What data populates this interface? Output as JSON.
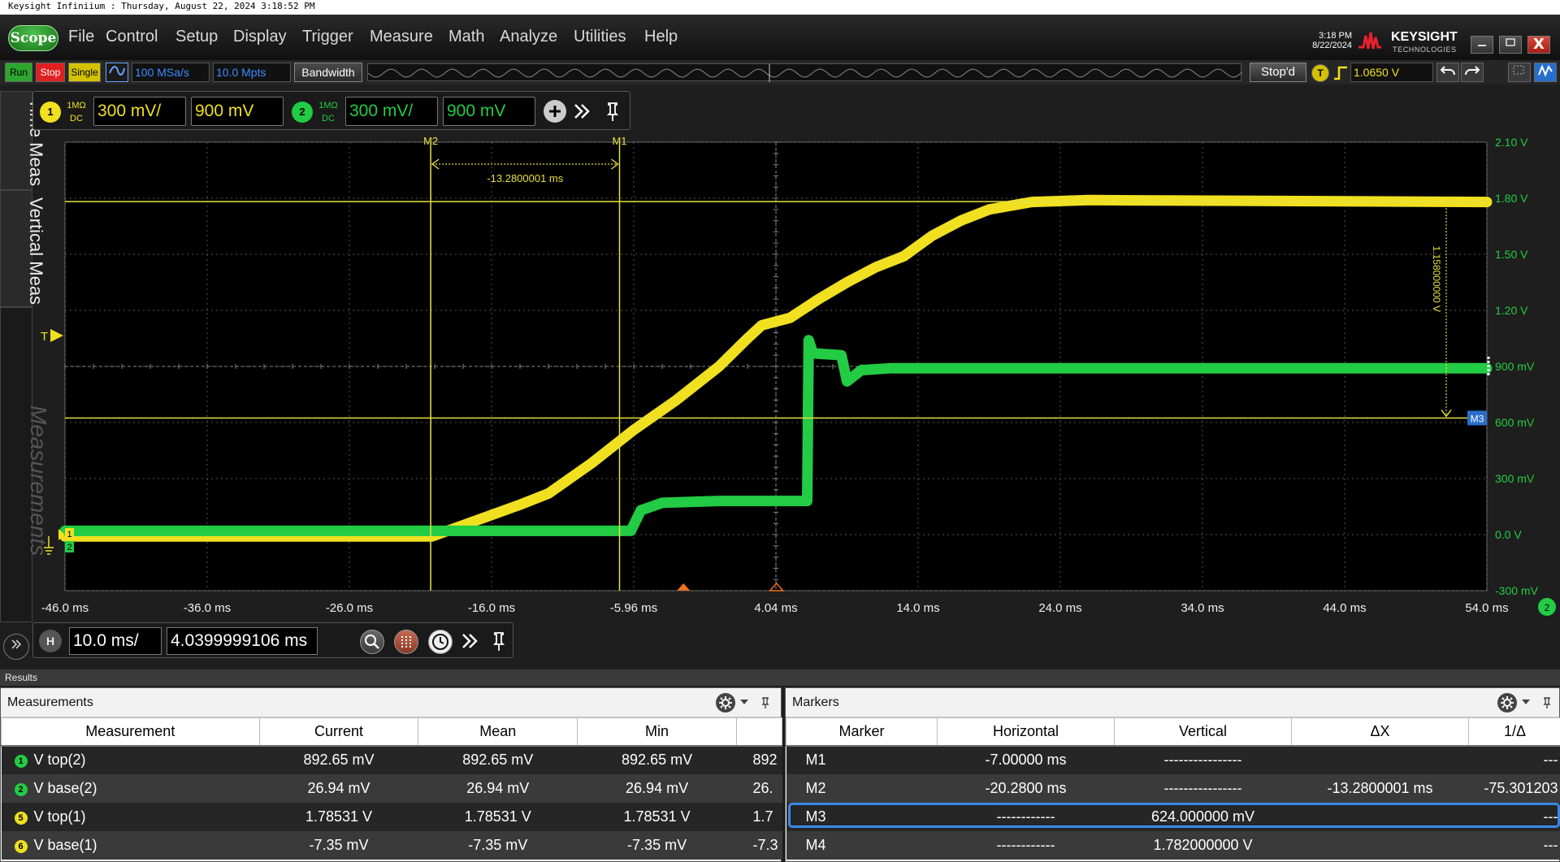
{
  "window": {
    "os_title": "Keysight Infiniium : Thursday, August 22, 2024 3:18:52 PM",
    "app_logo": "Scope",
    "clock_time": "3:18 PM",
    "clock_date": "8/22/2024",
    "brand": "KEYSIGHT",
    "brand_sub": "TECHNOLOGIES",
    "close_glyph": "X"
  },
  "menu": [
    "File",
    "Control",
    "Setup",
    "Display",
    "Trigger",
    "Measure",
    "Math",
    "Analyze",
    "Utilities",
    "Help"
  ],
  "toolbar": {
    "run": "Run",
    "stop": "Stop",
    "single": "Single",
    "sample_rate": "100 MSa/s",
    "memory_depth": "10.0 Mpts",
    "bandwidth": "Bandwidth",
    "status": "Stop'd",
    "trigger_badge": "T",
    "trigger_level": "1.0650 V"
  },
  "side_tabs": [
    "Time Meas",
    "Vertical Meas",
    "Measurements"
  ],
  "channels": [
    {
      "number": "1",
      "impedance": "1MΩ",
      "coupling": "DC",
      "scale": "300 mV/",
      "offset": "900 mV",
      "color": "#f0e020"
    },
    {
      "number": "2",
      "impedance": "1MΩ",
      "coupling": "DC",
      "scale": "300 mV/",
      "offset": "900 mV",
      "color": "#22cc44"
    }
  ],
  "plot": {
    "x_ticks": [
      "-46.0 ms",
      "-36.0 ms",
      "-26.0 ms",
      "-16.0 ms",
      "-5.96 ms",
      "4.04 ms",
      "14.0 ms",
      "24.0 ms",
      "34.0 ms",
      "44.0 ms",
      "54.0 ms"
    ],
    "y_ticks": [
      "2.10 V",
      "1.80 V",
      "1.50 V",
      "1.20 V",
      "900 mV",
      "600 mV",
      "300 mV",
      "0.0 V",
      "-300 mV"
    ],
    "trigger_marker": "T",
    "ch1_marker": "1",
    "ch2_marker": "2",
    "marker_m1": "M1",
    "marker_m2": "M2",
    "marker_m3": "M3",
    "delta_x_label": "-13.2800001 ms",
    "delta_y_label": "1.158000000 V",
    "x_range_ms": [
      -46,
      54
    ],
    "y_range_v": [
      -0.3,
      2.1
    ]
  },
  "timebase": {
    "badge": "H",
    "scale": "10.0 ms/",
    "position": "4.0399999106 ms"
  },
  "results": {
    "title": "Results",
    "measurements": {
      "title": "Measurements",
      "columns": [
        "Measurement",
        "Current",
        "Mean",
        "Min",
        ""
      ],
      "rows": [
        {
          "badge": "1",
          "badge_color": "#22cc44",
          "name": "V top(2)",
          "current": "892.65 mV",
          "mean": "892.65 mV",
          "min": "892.65 mV",
          "extra": "892"
        },
        {
          "badge": "2",
          "badge_color": "#22cc44",
          "name": "V base(2)",
          "current": "26.94 mV",
          "mean": "26.94 mV",
          "min": "26.94 mV",
          "extra": "26."
        },
        {
          "badge": "5",
          "badge_color": "#f0e020",
          "name": "V top(1)",
          "current": "1.78531 V",
          "mean": "1.78531 V",
          "min": "1.78531 V",
          "extra": "1.7"
        },
        {
          "badge": "6",
          "badge_color": "#f0e020",
          "name": "V base(1)",
          "current": "-7.35 mV",
          "mean": "-7.35 mV",
          "min": "-7.35 mV",
          "extra": "-7.3"
        }
      ]
    },
    "markers": {
      "title": "Markers",
      "columns": [
        "Marker",
        "Horizontal",
        "Vertical",
        "ΔX",
        "1/Δ"
      ],
      "rows": [
        {
          "name": "M1",
          "horizontal": "-7.00000 ms",
          "vertical": "----------------",
          "dx": "",
          "inv": "---"
        },
        {
          "name": "M2",
          "horizontal": "-20.2800 ms",
          "vertical": "----------------",
          "dx": "-13.2800001 ms",
          "inv": "-75.301203"
        },
        {
          "name": "M3",
          "horizontal": "------------",
          "vertical": "624.000000 mV",
          "dx": "",
          "inv": "---"
        },
        {
          "name": "M4",
          "horizontal": "------------",
          "vertical": "1.782000000 V",
          "dx": "",
          "inv": "---"
        }
      ]
    }
  }
}
